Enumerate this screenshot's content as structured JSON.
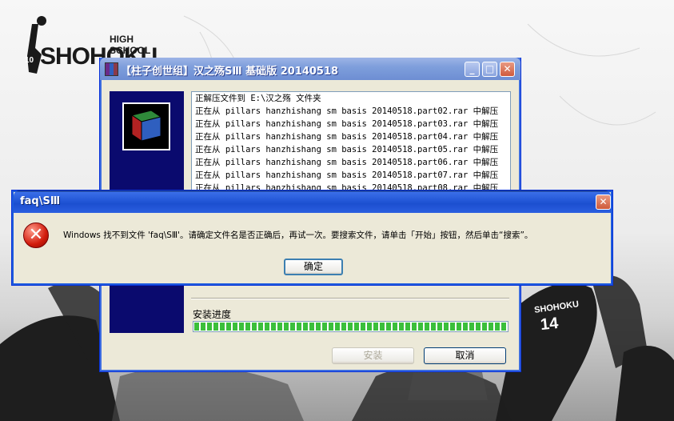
{
  "wallpaper": {
    "logo_text": "SHOHOKU",
    "logo_subtext": "HIGH SCHOOL",
    "logo_number": "10",
    "jersey_name": "SHOHOKU",
    "jersey_number": "14"
  },
  "installer": {
    "title": "【柱子创世组】汉之殇SⅢ 基础版 20140518",
    "log_lines": [
      "正解压文件到 E:\\汉之殇 文件夹",
      "正在从 pillars hanzhishang sm basis 20140518.part02.rar 中解压",
      "正在从 pillars hanzhishang sm basis 20140518.part03.rar 中解压",
      "正在从 pillars hanzhishang sm basis 20140518.part04.rar 中解压",
      "正在从 pillars hanzhishang sm basis 20140518.part05.rar 中解压",
      "正在从 pillars hanzhishang sm basis 20140518.part06.rar 中解压",
      "正在从 pillars hanzhishang sm basis 20140518.part07.rar 中解压",
      "正在从 pillars hanzhishang sm basis 20140518.part08.rar 中解压"
    ],
    "progress_label": "安装进度",
    "progress_value": 1.0,
    "install_button": "安装",
    "cancel_button": "取消"
  },
  "error_dialog": {
    "title": "faq\\SⅢ",
    "message": "Windows 找不到文件 'faq\\SⅢ'。请确定文件名是否正确后，再试一次。要搜索文件，请单击「开始」按钮，然后单击“搜索”。",
    "ok_button": "确定"
  },
  "colors": {
    "titlebar_active": "#2458d8",
    "titlebar_inactive": "#7f9fdc",
    "banner": "#0a0a6e",
    "progress": "#3bbf3b",
    "error_icon": "#d21c0c"
  },
  "icons": {
    "error": "error-x-icon",
    "archive": "winrar-archive-icon",
    "close": "close-icon",
    "minimize": "minimize-icon",
    "maximize": "maximize-icon"
  }
}
